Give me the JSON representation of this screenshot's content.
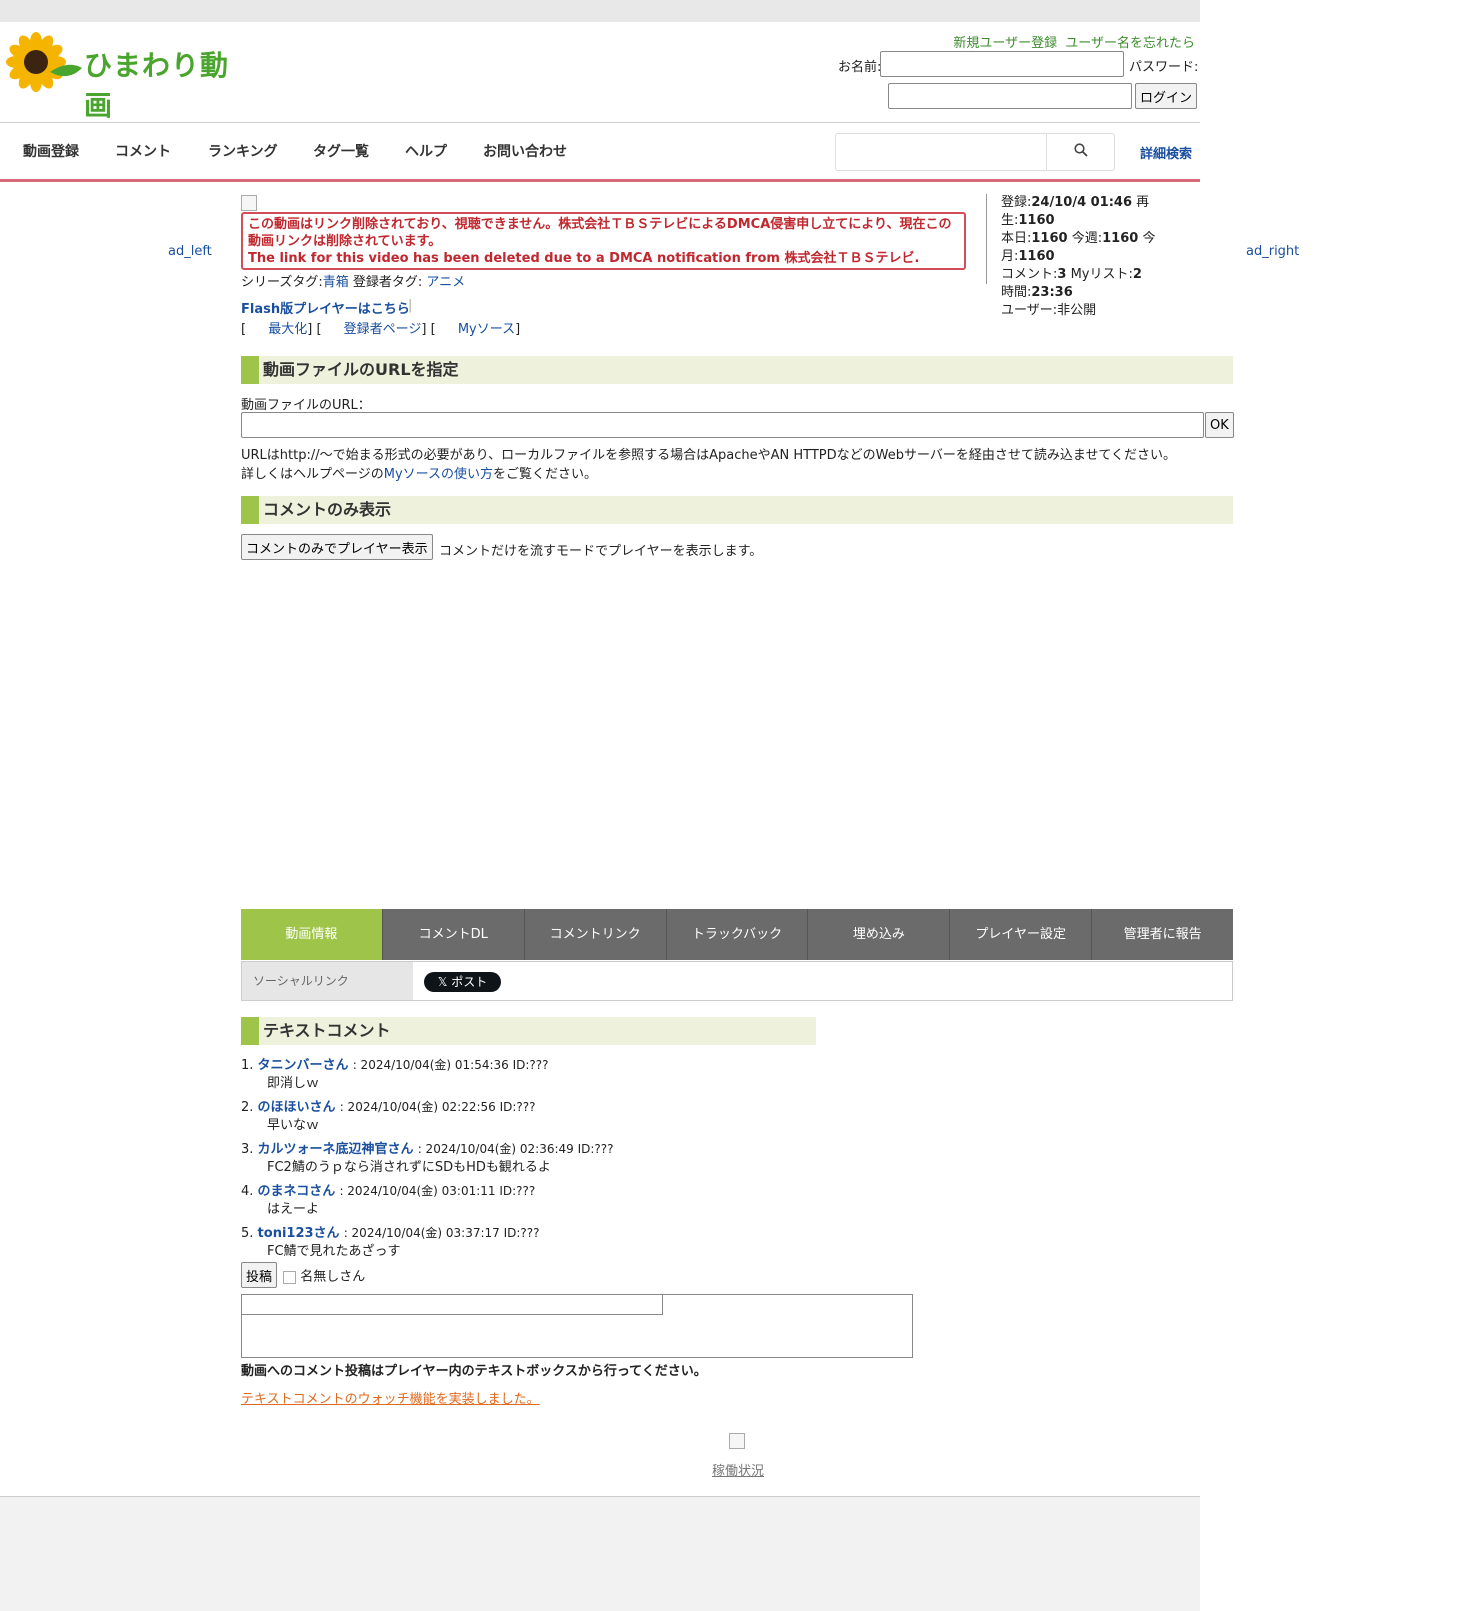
{
  "site": {
    "logo_text": "ひまわり動画"
  },
  "auth": {
    "register_link": "新規ユーザー登録",
    "forgot_link": "ユーザー名を忘れたら",
    "name_label": "お名前:",
    "password_label": "パスワード:",
    "login_button": "ログイン"
  },
  "nav": {
    "items": [
      "動画登録",
      "コメント",
      "ランキング",
      "タグ一覧",
      "ヘルプ",
      "お問い合わせ"
    ],
    "advanced_search": "詳細検索"
  },
  "ads": {
    "left": "ad_left",
    "right": "ad_right"
  },
  "notice": {
    "line_ja": "この動画はリンク削除されており、視聴できません。株式会社ＴＢＳテレビによるDMCA侵害申し立てにより、現在この動画リンクは削除されています。",
    "line_en": "The link for this video has been deleted due to a DMCA notification from 株式会社ＴＢＳテレビ."
  },
  "tags": {
    "series_label": "シリーズタグ:",
    "series_value": "青箱",
    "uploader_label": "登録者タグ:",
    "uploader_value": "アニメ"
  },
  "stats": {
    "reg_label": "登録:",
    "reg_value": "24/10/4 01:46",
    "play_label": "再生:",
    "play_value": "1160",
    "today_label": "本日:",
    "today_value": "1160",
    "week_label": "今週:",
    "week_value": "1160",
    "month_label": "今月:",
    "month_value": "1160",
    "comment_label": "コメント:",
    "comment_value": "3",
    "mylist_label": "Myリスト:",
    "mylist_value": "2",
    "time_label": "時間:",
    "time_value": "23:36",
    "user_label": "ユーザー:",
    "user_value": "非公開"
  },
  "player_links": {
    "flash": "Flash版プレイヤーはこちら",
    "maximize": "最大化",
    "uploader_page": "登録者ページ",
    "mysource": "Myソース"
  },
  "url_section": {
    "heading": "動画ファイルのURLを指定",
    "field_label": "動画ファイルのURL：",
    "ok_button": "OK",
    "help1": "URLはhttp://〜で始まる形式の必要があり、ローカルファイルを参照する場合はApacheやAN HTTPDなどのWebサーバーを経由させて読み込ませてください。",
    "help2_pre": "詳しくはヘルプページの",
    "help2_link": "Myソースの使い方",
    "help2_post": "をご覧ください。"
  },
  "comment_only": {
    "heading": "コメントのみ表示",
    "button": "コメントのみでプレイヤー表示",
    "desc": "コメントだけを流すモードでプレイヤーを表示します。"
  },
  "tabs": [
    "動画情報",
    "コメントDL",
    "コメントリンク",
    "トラックバック",
    "埋め込み",
    "プレイヤー設定",
    "管理者に報告"
  ],
  "social": {
    "label": "ソーシャルリンク",
    "x_post": "𝕏 ポスト"
  },
  "text_comments": {
    "heading": "テキストコメント",
    "items": [
      {
        "num": "1.",
        "name": "タニンバーさん",
        "meta": ": 2024/10/04(金) 01:54:36 ID:???",
        "body": "即消しｗ"
      },
      {
        "num": "2.",
        "name": "のほほいさん",
        "meta": ": 2024/10/04(金) 02:22:56 ID:???",
        "body": "早いなｗ"
      },
      {
        "num": "3.",
        "name": "カルツォーネ底辺神官さん",
        "meta": ": 2024/10/04(金) 02:36:49 ID:???",
        "body": "FC2鯖のうｐなら消されずにSDもHDも観れるよ"
      },
      {
        "num": "4.",
        "name": "のまネコさん",
        "meta": ": 2024/10/04(金) 03:01:11 ID:???",
        "body": "はえーよ"
      },
      {
        "num": "5.",
        "name": "toni123さん",
        "meta": ": 2024/10/04(金) 03:37:17 ID:???",
        "body": "FC鯖で見れたあざっす"
      }
    ],
    "post_button": "投稿",
    "anon_label": "名無しさん",
    "post_note": "動画へのコメント投稿はプレイヤー内のテキストボックスから行ってください。",
    "watch_link": "テキストコメントのウォッチ機能を実装しました。"
  },
  "footer": {
    "status_link": "稼働状況"
  }
}
